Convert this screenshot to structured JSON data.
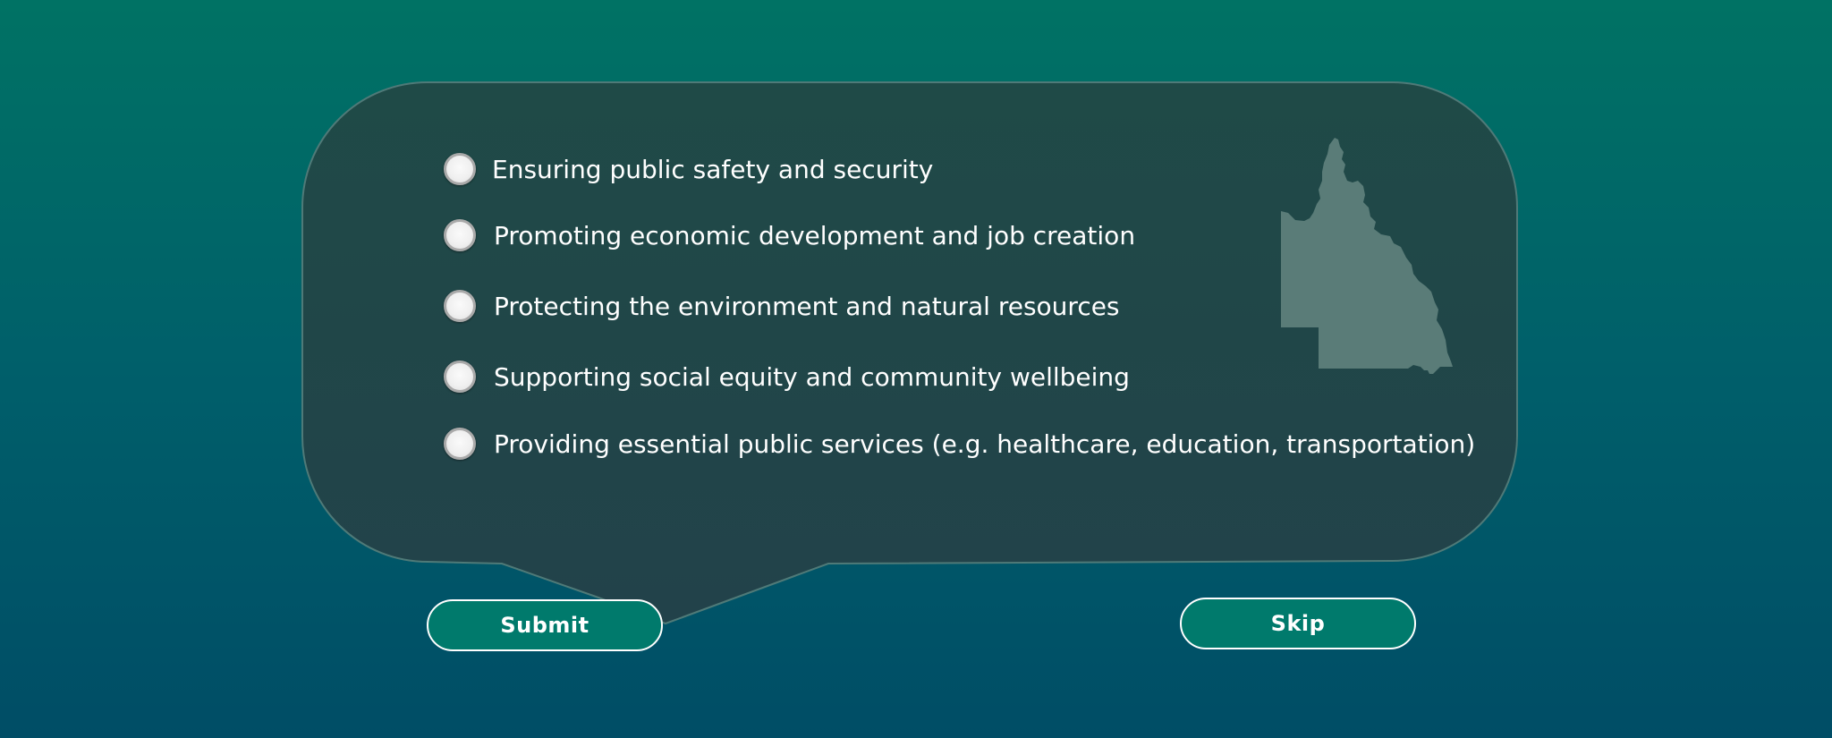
{
  "survey": {
    "options": [
      {
        "label": "Ensuring public safety and security",
        "selected": false
      },
      {
        "label": "Promoting economic development and job creation",
        "selected": false
      },
      {
        "label": "Protecting the environment and natural resources",
        "selected": false
      },
      {
        "label": "Supporting social equity and community wellbeing",
        "selected": false
      },
      {
        "label": "Providing essential public services (e.g. healthcare, education, transportation)",
        "selected": false
      }
    ],
    "map_icon": "queensland-map-icon"
  },
  "actions": {
    "submit_label": "Submit",
    "skip_label": "Skip"
  },
  "colors": {
    "background_top": "#007264",
    "background_bottom": "#004d66",
    "bubble_fill": "#1e4a48",
    "map_fill": "#5a7c78",
    "button_fill": "#007a6c",
    "text": "#ffffff"
  }
}
